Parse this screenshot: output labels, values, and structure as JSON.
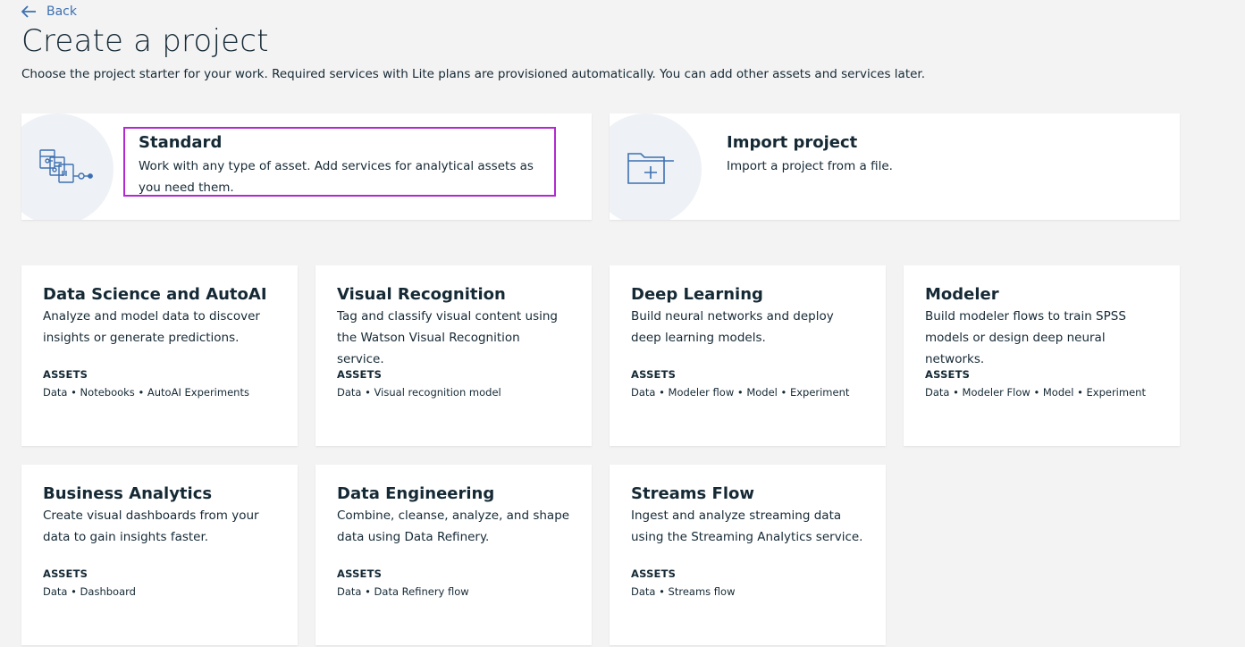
{
  "back_label": "Back",
  "page_title": "Create a project",
  "subtitle": "Choose the project starter for your work. Required services with Lite plans are provisioned automatically. You can add other assets and services later.",
  "starters": [
    {
      "title": "Standard",
      "description": "Work with any type of asset. Add services for analytical assets as you need them.",
      "icon": "workflow-diagram-icon"
    },
    {
      "title": "Import project",
      "description": "Import a project from a file.",
      "icon": "folder-add-icon"
    }
  ],
  "assets_heading": "ASSETS",
  "cards": [
    {
      "title": "Data Science and AutoAI",
      "description": "Analyze and model data to discover insights or generate predictions.",
      "assets": "Data • Notebooks • AutoAI Experiments"
    },
    {
      "title": "Visual Recognition",
      "description": "Tag and classify visual content using the Watson Visual Recognition service.",
      "assets": "Data • Visual recognition model"
    },
    {
      "title": "Deep Learning",
      "description": "Build neural networks and deploy deep learning models.",
      "assets": "Data • Modeler flow • Model • Experiment"
    },
    {
      "title": "Modeler",
      "description": "Build modeler flows to train SPSS models or design deep neural networks.",
      "assets": "Data • Modeler Flow • Model • Experiment"
    },
    {
      "title": "Business Analytics",
      "description": "Create visual dashboards from your data to gain insights faster.",
      "assets": "Data • Dashboard"
    },
    {
      "title": "Data Engineering",
      "description": "Combine, cleanse, analyze, and shape data using Data Refinery.",
      "assets": "Data • Data Refinery flow"
    },
    {
      "title": "Streams Flow",
      "description": "Ingest and analyze streaming data using the Streaming Analytics service.",
      "assets": "Data • Streams flow"
    }
  ],
  "colors": {
    "link": "#3d70b2",
    "highlight": "#b328d1",
    "text": "#152935",
    "background": "#f3f3f3"
  }
}
